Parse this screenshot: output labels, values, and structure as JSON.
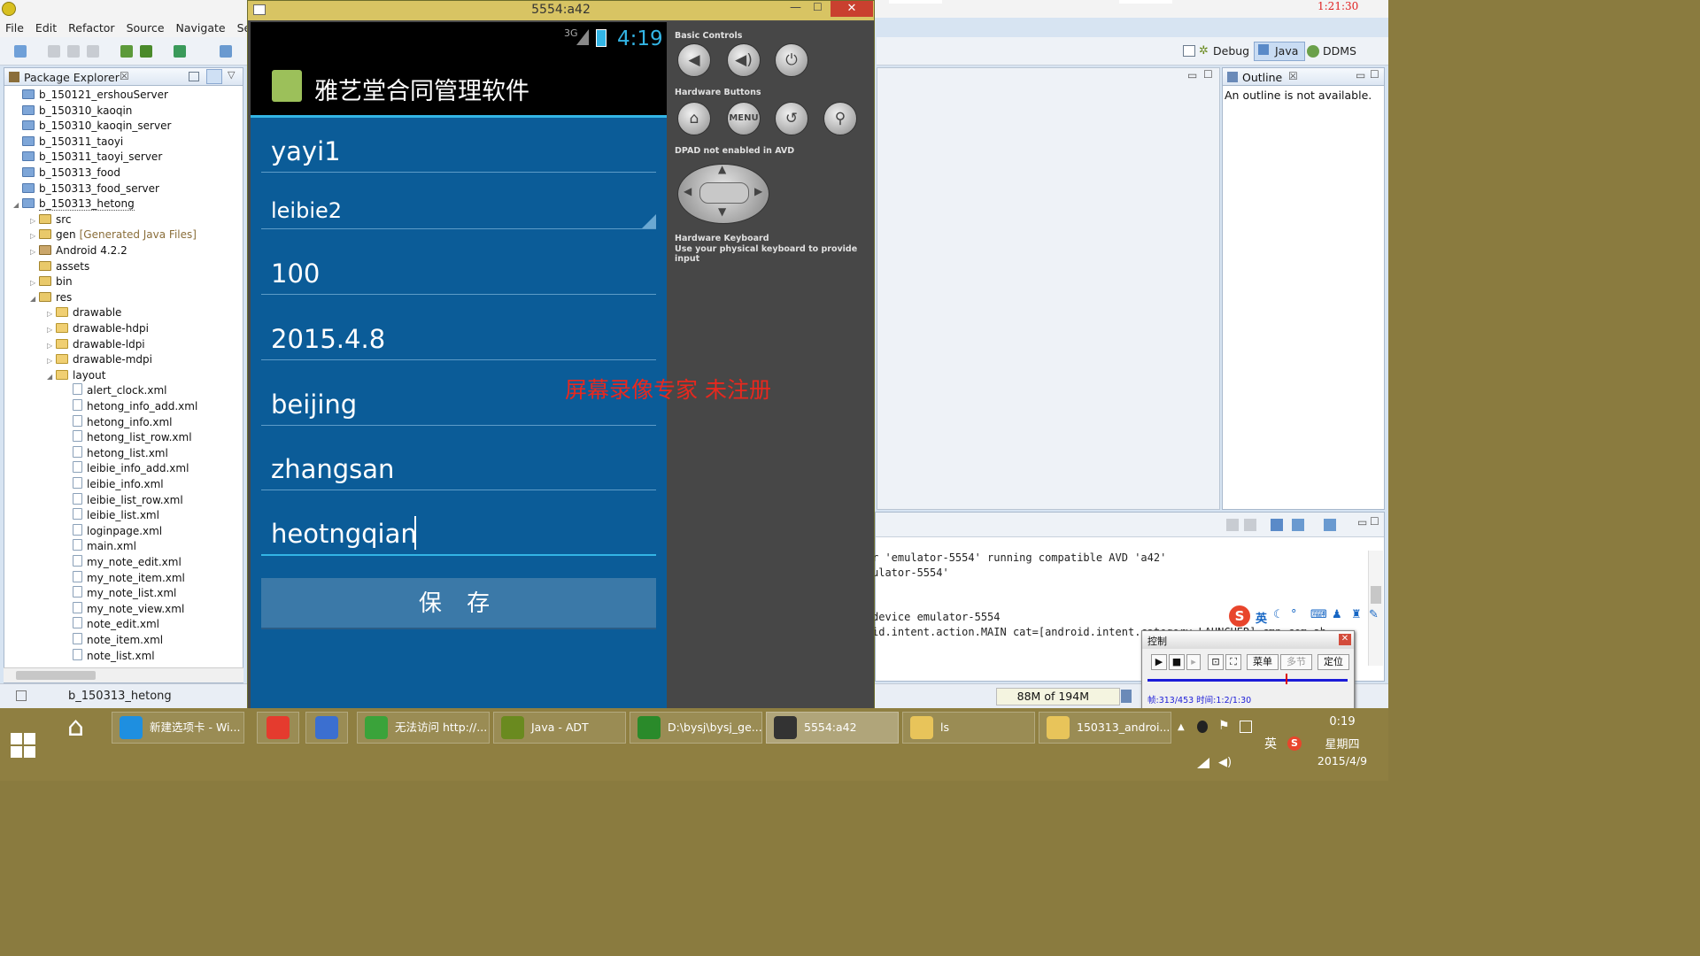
{
  "eclipse": {
    "menu": [
      "File",
      "Edit",
      "Refactor",
      "Source",
      "Navigate",
      "Sea"
    ],
    "package_explorer_title": "Package Explorer",
    "tree": [
      {
        "label": "b_150121_ershouServer",
        "indent": 0,
        "icon": "proj",
        "tri": ""
      },
      {
        "label": "b_150310_kaoqin",
        "indent": 0,
        "icon": "proj",
        "tri": ""
      },
      {
        "label": "b_150310_kaoqin_server",
        "indent": 0,
        "icon": "proj",
        "tri": ""
      },
      {
        "label": "b_150311_taoyi",
        "indent": 0,
        "icon": "proj",
        "tri": ""
      },
      {
        "label": "b_150311_taoyi_server",
        "indent": 0,
        "icon": "proj",
        "tri": ""
      },
      {
        "label": "b_150313_food",
        "indent": 0,
        "icon": "proj",
        "tri": ""
      },
      {
        "label": "b_150313_food_server",
        "indent": 0,
        "icon": "proj",
        "tri": ""
      },
      {
        "label": "b_150313_hetong",
        "indent": 0,
        "icon": "proj",
        "tri": "◢"
      },
      {
        "label": "src",
        "indent": 1,
        "icon": "pkg",
        "tri": "▷"
      },
      {
        "label": "gen",
        "extra": "[Generated Java Files]",
        "indent": 1,
        "icon": "pkg",
        "tri": "▷"
      },
      {
        "label": "Android 4.2.2",
        "indent": 1,
        "icon": "lib",
        "tri": "▷"
      },
      {
        "label": "assets",
        "indent": 1,
        "icon": "pkg",
        "tri": ""
      },
      {
        "label": "bin",
        "indent": 1,
        "icon": "pkg",
        "tri": "▷"
      },
      {
        "label": "res",
        "indent": 1,
        "icon": "pkg",
        "tri": "◢"
      },
      {
        "label": "drawable",
        "indent": 2,
        "icon": "fold",
        "tri": "▷"
      },
      {
        "label": "drawable-hdpi",
        "indent": 2,
        "icon": "fold",
        "tri": "▷"
      },
      {
        "label": "drawable-ldpi",
        "indent": 2,
        "icon": "fold",
        "tri": "▷"
      },
      {
        "label": "drawable-mdpi",
        "indent": 2,
        "icon": "fold",
        "tri": "▷"
      },
      {
        "label": "layout",
        "indent": 2,
        "icon": "fold",
        "tri": "◢"
      },
      {
        "label": "alert_clock.xml",
        "indent": 3,
        "icon": "xml",
        "tri": ""
      },
      {
        "label": "hetong_info_add.xml",
        "indent": 3,
        "icon": "xml",
        "tri": ""
      },
      {
        "label": "hetong_info.xml",
        "indent": 3,
        "icon": "xml",
        "tri": ""
      },
      {
        "label": "hetong_list_row.xml",
        "indent": 3,
        "icon": "xml",
        "tri": ""
      },
      {
        "label": "hetong_list.xml",
        "indent": 3,
        "icon": "xml",
        "tri": ""
      },
      {
        "label": "leibie_info_add.xml",
        "indent": 3,
        "icon": "xml",
        "tri": ""
      },
      {
        "label": "leibie_info.xml",
        "indent": 3,
        "icon": "xml",
        "tri": ""
      },
      {
        "label": "leibie_list_row.xml",
        "indent": 3,
        "icon": "xml",
        "tri": ""
      },
      {
        "label": "leibie_list.xml",
        "indent": 3,
        "icon": "xml",
        "tri": ""
      },
      {
        "label": "loginpage.xml",
        "indent": 3,
        "icon": "xml",
        "tri": ""
      },
      {
        "label": "main.xml",
        "indent": 3,
        "icon": "xml",
        "tri": ""
      },
      {
        "label": "my_note_edit.xml",
        "indent": 3,
        "icon": "xml",
        "tri": ""
      },
      {
        "label": "my_note_item.xml",
        "indent": 3,
        "icon": "xml",
        "tri": ""
      },
      {
        "label": "my_note_list.xml",
        "indent": 3,
        "icon": "xml",
        "tri": ""
      },
      {
        "label": "my_note_view.xml",
        "indent": 3,
        "icon": "xml",
        "tri": ""
      },
      {
        "label": "note_edit.xml",
        "indent": 3,
        "icon": "xml",
        "tri": ""
      },
      {
        "label": "note_item.xml",
        "indent": 3,
        "icon": "xml",
        "tri": ""
      },
      {
        "label": "note_list.xml",
        "indent": 3,
        "icon": "xml",
        "tri": ""
      }
    ],
    "status_project": "b_150313_hetong",
    "heap": "88M of 194M",
    "perspectives": [
      "Debug",
      "Java",
      "DDMS"
    ],
    "outline_title": "Outline",
    "outline_msg": "An outline is not available.",
    "console_lines": [
      "r 'emulator-5554' running compatible AVD 'a42'",
      "ulator-5554'",
      "",
      "",
      "device emulator-5554",
      "id.intent.action.MAIN cat=[android.intent.category.LAUNCHER] cmp=com.ab,"
    ]
  },
  "emulator": {
    "window_title": "5554:a42",
    "close": "✕",
    "net": "3G",
    "clock": "4:19",
    "app_title": "雅艺堂合同管理软件",
    "fields": [
      "yayi1",
      "leibie2",
      "100",
      "2015.4.8",
      "beijing",
      "zhangsan",
      "heotngqian"
    ],
    "save_label": "保 存",
    "controls": {
      "basic_controls": "Basic Controls",
      "hardware_buttons": "Hardware Buttons",
      "dpad": "DPAD not enabled in AVD",
      "keyboard_title": "Hardware Keyboard",
      "keyboard_desc": "Use your physical keyboard to provide input",
      "menu": "MENU"
    }
  },
  "watermark": "屏幕录像专家  未注册",
  "recorder": {
    "title": "控制",
    "menu": "菜单",
    "multi": "多节",
    "locate": "定位",
    "info": "帧:313/453 时间:1:2/1:30",
    "progress": 0.69,
    "timer": "1:21:30"
  },
  "ime": {
    "lang": "英"
  },
  "taskbar": {
    "tasks": [
      {
        "label": "新建选项卡 - Wi...",
        "color": "#1e8fe0"
      },
      {
        "label": "",
        "color": "#e53b2e"
      },
      {
        "label": "",
        "color": "#3b6fd0"
      },
      {
        "label": "无法访问 http://...",
        "color": "#3aa33a"
      },
      {
        "label": "Java - ADT",
        "color": "#6a8a1f"
      },
      {
        "label": "D:\\bysj\\bysj_ge...",
        "color": "#2a8a2a"
      },
      {
        "label": "5554:a42",
        "color": "#333"
      },
      {
        "label": "ls",
        "color": "#e8c45a"
      },
      {
        "label": "150313_androi...",
        "color": "#e8c45a"
      }
    ],
    "time": "0:19",
    "weekday": "星期四",
    "date": "2015/4/9",
    "lang": "英"
  }
}
